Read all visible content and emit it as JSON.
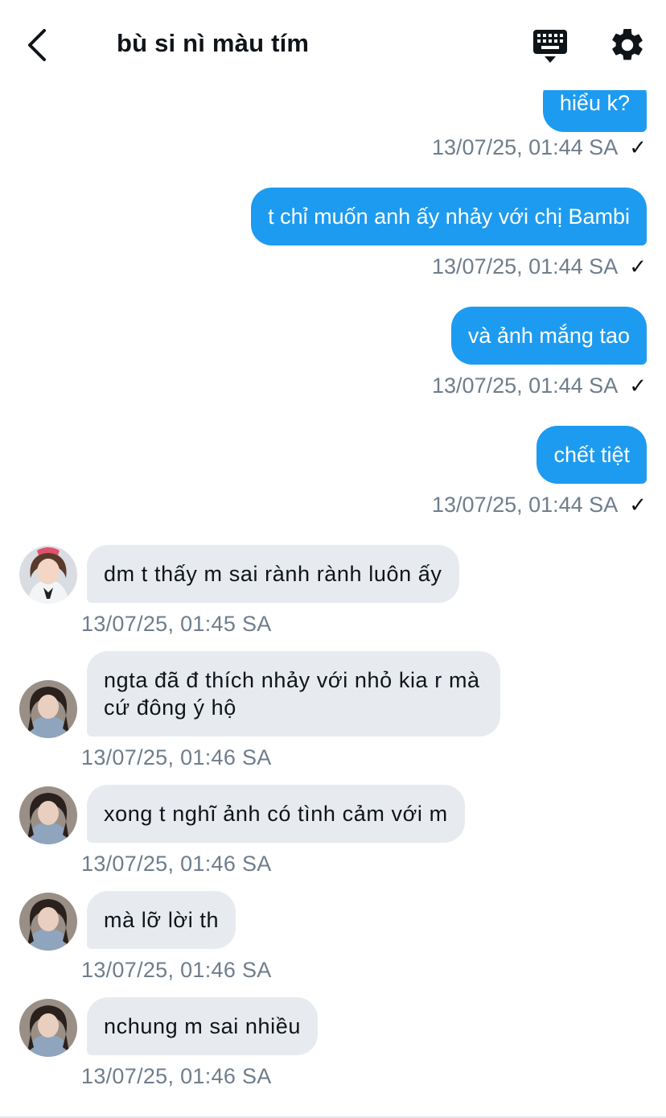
{
  "header": {
    "title": "bù si nì màu tím",
    "back_icon": "chevron-left-icon",
    "keyboard_icon": "keyboard-icon",
    "settings_icon": "gear-icon"
  },
  "colors": {
    "outgoing_bubble": "#1d9bf0",
    "incoming_bubble": "#e7ebef",
    "timestamp": "#6f7d8c"
  },
  "messages_out": [
    {
      "text": "hiểu k?",
      "time": "13/07/25, 01:44 SA"
    },
    {
      "text": "t chỉ muốn anh ấy nhảy với chị Bambi",
      "time": "13/07/25, 01:44 SA"
    },
    {
      "text": "và ảnh mắng tao",
      "time": "13/07/25, 01:44 SA"
    },
    {
      "text": "chết tiệt",
      "time": "13/07/25, 01:44 SA"
    }
  ],
  "messages_in": [
    {
      "text": "dm t thấy m sai rành rành luôn ấy",
      "time": "13/07/25, 01:45 SA"
    },
    {
      "text": "ngta đã đ thích nhảy với nhỏ kia r mà cứ đông ý hộ",
      "time": "13/07/25, 01:46 SA"
    },
    {
      "text": "xong t nghĩ ảnh có tình cảm với m",
      "time": "13/07/25, 01:46 SA"
    },
    {
      "text": "mà lỡ lời th",
      "time": "13/07/25, 01:46 SA"
    },
    {
      "text": "nchung m sai nhiều",
      "time": "13/07/25, 01:46 SA"
    }
  ],
  "read_mark": "✓"
}
